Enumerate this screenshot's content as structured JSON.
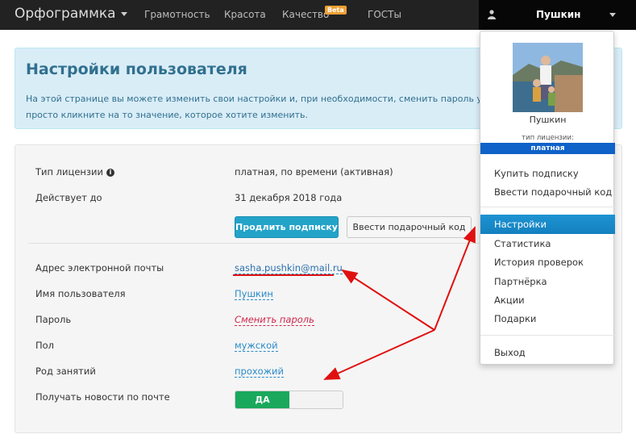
{
  "navbar": {
    "brand": "Орфограммка",
    "items": [
      "Грамотность",
      "Красота",
      "Качество",
      "ГОСТы"
    ],
    "beta_badge": "Beta",
    "user_name": "Пушкин"
  },
  "info": {
    "title": "Настройки пользователя",
    "line1": "На этой странице вы можете изменить свои настройки и, при необходимости, сменить пароль учётной",
    "line2": "просто кликните на то значение, которое хотите изменить."
  },
  "settings": {
    "license_label": "Тип лицензии",
    "license_value": "платная, по времени (активная)",
    "valid_label": "Действует до",
    "valid_value": "31 декабря 2018 года",
    "extend_button": "Продлить подписку",
    "gift_button": "Ввести подарочный код",
    "email_label": "Адрес электронной почты",
    "email_value": "sasha.pushkin@mail.ru",
    "username_label": "Имя пользователя",
    "username_value": "Пушкин",
    "password_label": "Пароль",
    "password_value": "Сменить пароль",
    "gender_label": "Пол",
    "gender_value": "мужской",
    "occupation_label": "Род занятий",
    "occupation_value": "прохожий",
    "news_label": "Получать новости по почте",
    "news_toggle": "ДА"
  },
  "dropdown": {
    "name": "Пушкин",
    "license_label": "тип лицензии:",
    "license_badge": "платная",
    "items_top": [
      "Купить подписку",
      "Ввести подарочный код"
    ],
    "active_item": "Настройки",
    "items_mid": [
      "Статистика",
      "История проверок",
      "Партнёрка",
      "Акции",
      "Подарки"
    ],
    "logout": "Выход"
  },
  "colors": {
    "navbar": "#222222",
    "info_bg": "#d9edf7",
    "primary": "#24a3c9",
    "toggle_on": "#1aa85c",
    "active_menu": "#1480bf",
    "annotation_arrow": "#e01010"
  }
}
